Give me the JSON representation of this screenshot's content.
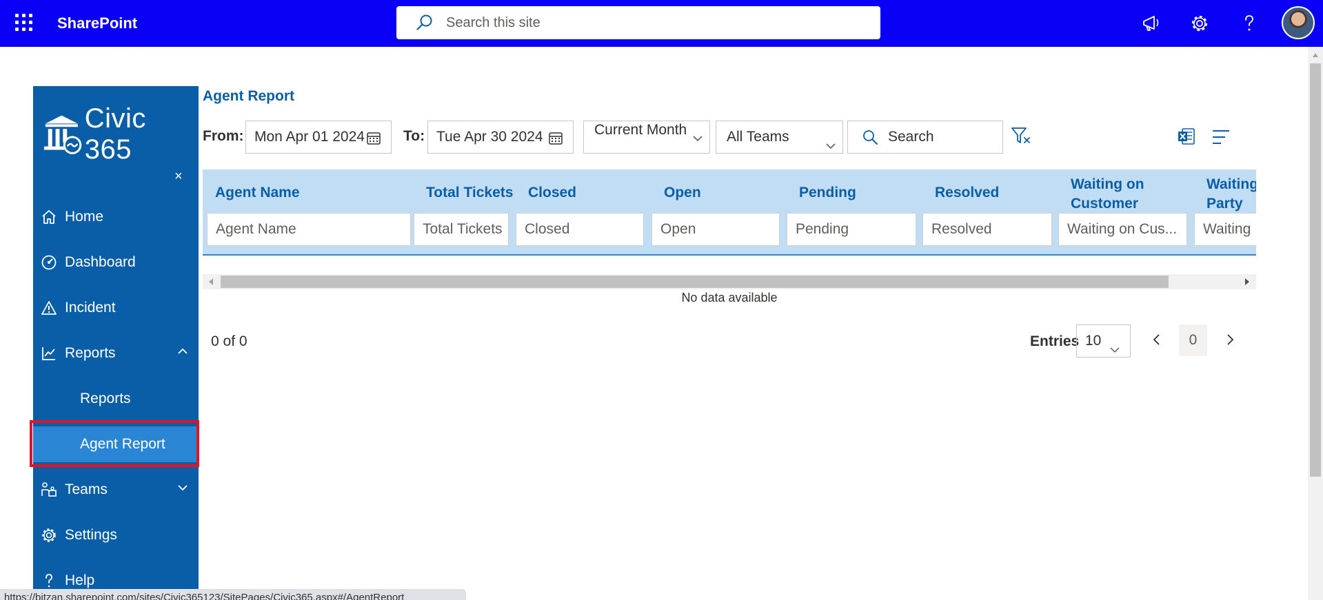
{
  "suitebar": {
    "brand": "SharePoint",
    "search_placeholder": "Search this site",
    "bg_color": "#0a00f5"
  },
  "nav": {
    "logo_text": "Civic 365",
    "close_glyph": "×",
    "items": [
      {
        "label": "Home",
        "icon": "home-icon"
      },
      {
        "label": "Dashboard",
        "icon": "dashboard-icon"
      },
      {
        "label": "Incident",
        "icon": "warning-icon"
      },
      {
        "label": "Reports",
        "icon": "chart-icon"
      },
      {
        "label": "Teams",
        "icon": "teams-icon"
      },
      {
        "label": "Settings",
        "icon": "gear-icon"
      },
      {
        "label": "Help",
        "icon": "help-icon"
      }
    ],
    "subitems": [
      "Reports",
      "Agent Report"
    ],
    "bg_color": "#0a5ea8",
    "active_color": "#2a86d4"
  },
  "report": {
    "title": "Agent Report",
    "from_label": "From:",
    "from_value": "Mon Apr 01 2024",
    "to_label": "To:",
    "to_value": "Tue Apr 30 2024",
    "period_value": "Current Month",
    "team_value": "All Teams",
    "search_placeholder": "Search"
  },
  "grid": {
    "columns": [
      {
        "header": "Agent Name",
        "filter": "Agent Name"
      },
      {
        "header": "Total Tickets",
        "filter": "Total Tickets"
      },
      {
        "header": "Closed",
        "filter": "Closed"
      },
      {
        "header": "Open",
        "filter": "Open"
      },
      {
        "header": "Pending",
        "filter": "Pending"
      },
      {
        "header": "Resolved",
        "filter": "Resolved"
      },
      {
        "header": "Waiting on Customer",
        "filter": "Waiting on Cus..."
      },
      {
        "header": "Waiting Party",
        "filter": "Waiting"
      }
    ],
    "empty_text": "No data available",
    "header_bg": "#c1ddf4"
  },
  "pager": {
    "count_text": "0 of 0",
    "entries_label": "Entries",
    "entries_value": "10",
    "current_page": "0"
  },
  "status_url": "https://bitzan.sharepoint.com/sites/Civic365123/SitePages/Civic365.aspx#/AgentReport"
}
